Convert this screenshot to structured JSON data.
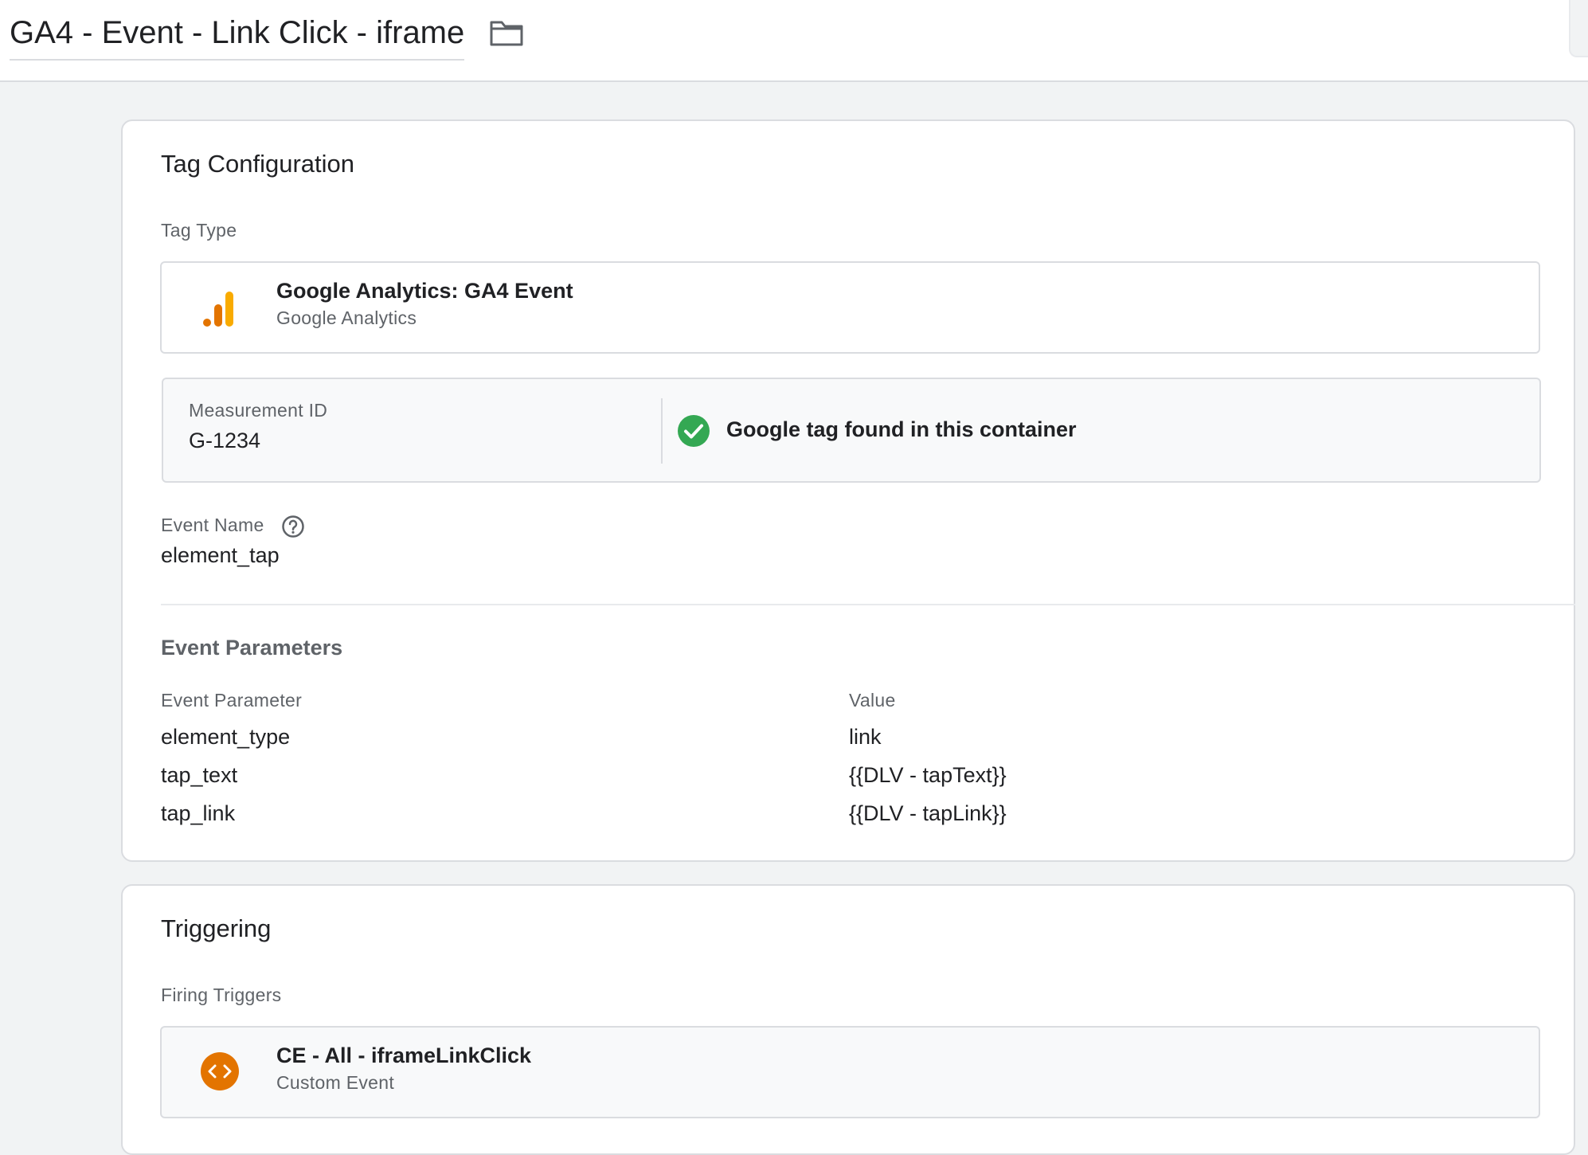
{
  "header": {
    "tag_name": "GA4 - Event - Link Click - iframe",
    "folder_icon": "folder-icon"
  },
  "tag_configuration": {
    "title": "Tag Configuration",
    "tag_type_label": "Tag Type",
    "tag_type": {
      "name": "Google Analytics: GA4 Event",
      "provider": "Google Analytics",
      "icon": "google-analytics-icon",
      "icon_colors": [
        "#e37400",
        "#f9ab00"
      ]
    },
    "measurement": {
      "label": "Measurement ID",
      "value": "G-1234",
      "status_text": "Google tag found in this container",
      "status_icon": "check-circle-icon",
      "status_color": "#34a853"
    },
    "event_name": {
      "label": "Event Name",
      "value": "element_tap",
      "help_icon": "help-icon"
    },
    "event_parameters": {
      "section_label": "Event Parameters",
      "columns": [
        "Event Parameter",
        "Value"
      ],
      "rows": [
        {
          "parameter": "element_type",
          "value": "link"
        },
        {
          "parameter": "tap_text",
          "value": "{{DLV - tapText}}"
        },
        {
          "parameter": "tap_link",
          "value": "{{DLV - tapLink}}"
        }
      ]
    }
  },
  "triggering": {
    "title": "Triggering",
    "firing_triggers_label": "Firing Triggers",
    "triggers": [
      {
        "name": "CE - All - iframeLinkClick",
        "type": "Custom Event",
        "icon": "code-icon",
        "icon_color": "#e37400"
      }
    ]
  }
}
